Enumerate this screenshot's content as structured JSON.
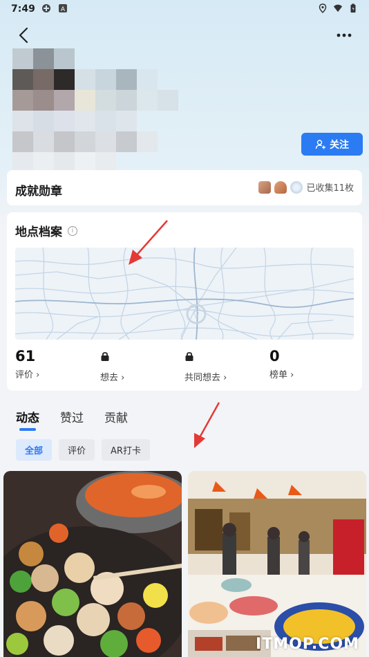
{
  "status_bar": {
    "time": "7:49"
  },
  "profile": {
    "follow_label": "关注"
  },
  "badges": {
    "title": "成就勋章",
    "collected_text": "已收集11枚"
  },
  "places": {
    "title": "地点档案",
    "stats": [
      {
        "value": "61",
        "label": "评价 ›"
      },
      {
        "value": "",
        "label": "想去 ›"
      },
      {
        "value": "",
        "label": "共同想去 ›"
      },
      {
        "value": "0",
        "label": "榜单 ›"
      }
    ]
  },
  "feed": {
    "tabs": [
      "动态",
      "赞过",
      "贡献"
    ],
    "filters": [
      "全部",
      "评价",
      "AR打卡"
    ]
  },
  "watermark": "ITMOP.COM",
  "colors": {
    "accent": "#2b7bf3",
    "arrow": "#e53935"
  }
}
